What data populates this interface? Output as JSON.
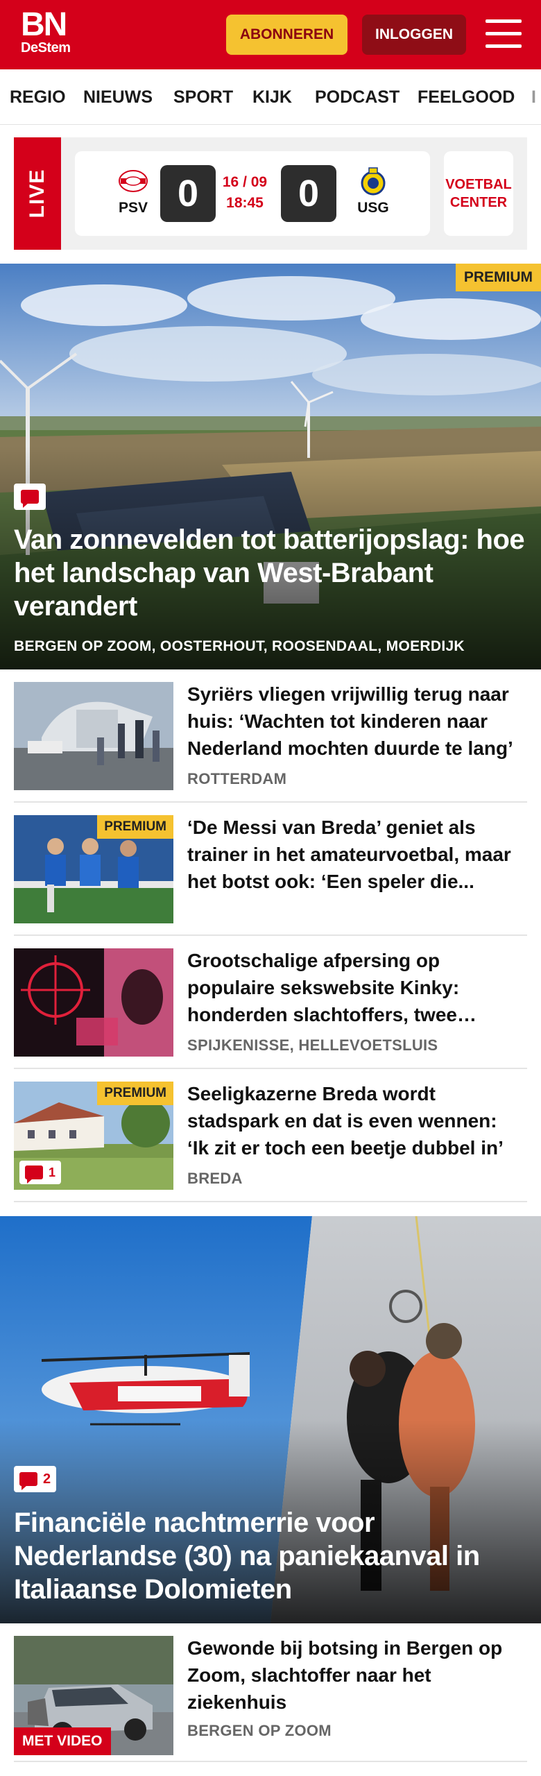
{
  "header": {
    "logo_main": "BN",
    "logo_sub": "DeStem",
    "subscribe_label": "ABONNEREN",
    "login_label": "INLOGGEN",
    "menu_icon": "hamburger-icon"
  },
  "nav": {
    "items": [
      "REGIO",
      "NIEUWS",
      "SPORT",
      "KIJK",
      "PODCAST",
      "FEELGOOD",
      "I"
    ]
  },
  "live": {
    "label": "LIVE",
    "home_team": "PSV",
    "away_team": "USG",
    "home_score": "0",
    "away_score": "0",
    "date": "16 / 09",
    "time": "18:45",
    "center_line1": "VOETBAL",
    "center_line2": "CENTER"
  },
  "hero1": {
    "premium": "PREMIUM",
    "title": "Van zonnevelden tot batterijopslag: hoe het landschap van West-Brabant verandert",
    "locations": "BERGEN OP ZOOM, OOSTERHOUT, ROOSENDAAL, MOERDIJK"
  },
  "articles": [
    {
      "title": "Syriërs vliegen vrijwillig terug naar huis: ‘Wachten tot kinderen naar Nederland mochten duurde te lang’",
      "location": "ROTTERDAM"
    },
    {
      "premium": "PREMIUM",
      "title": "‘De Messi van Breda’ geniet als trainer in het amateurvoetbal, maar het botst ook: ‘Een speler die..."
    },
    {
      "title": "Grootschalige afpersing op populaire sekswebsite Kinky: honderden slachtoffers, twee verdachten",
      "location": "SPIJKENISSE, HELLEVOETSLUIS"
    },
    {
      "premium": "PREMIUM",
      "title": "Seeligkazerne Breda wordt stadspark en dat is even wennen: ‘Ik zit er toch een beetje dubbel in’",
      "location": "BREDA",
      "comments": "1"
    }
  ],
  "hero2": {
    "comments": "2",
    "title": "Financiële nachtmerrie voor Nederlandse (30) na paniekaanval in Italiaanse Dolomieten"
  },
  "article_video": {
    "title": "Gewonde bij botsing in Bergen op Zoom, slachtoffer naar het ziekenhuis",
    "location": "BERGEN OP ZOOM",
    "video_label": "MET VIDEO"
  },
  "colors": {
    "brand_red": "#d4001a",
    "premium_yellow": "#f5c230",
    "dark_red": "#8f0d16"
  }
}
